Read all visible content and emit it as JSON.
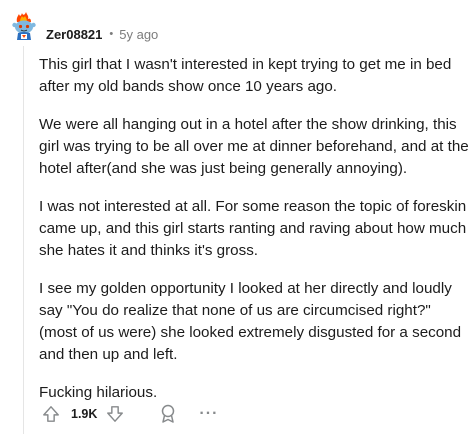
{
  "comment": {
    "author": "Zer08821",
    "separator": "•",
    "age": "5y ago",
    "avatar_icon": "snoo-avatar-icon",
    "paragraphs": [
      "This girl that I wasn't interested in kept trying to get me in bed after my old bands show once 10 years ago.",
      "We were all hanging out in a hotel after the show drinking, this girl was trying to be all over me at dinner beforehand, and at the hotel after(and she was just being generally annoying).",
      "I was not interested at all. For some reason the topic of foreskin came up, and this girl starts ranting and raving about how much she hates it and thinks it's gross.",
      "I see my golden opportunity I looked at her directly and loudly say \"You do realize that none of us are circumcised right?\" (most of us were) she looked extremely disgusted for a second and then up and left.",
      "Fucking hilarious."
    ],
    "actions": {
      "upvote_icon": "upvote-arrow-icon",
      "score": "1.9K",
      "downvote_icon": "downvote-arrow-icon",
      "award_icon": "award-icon",
      "more_icon": "more-options-icon",
      "more_label": "···"
    }
  },
  "colors": {
    "text": "#1c1c1c",
    "meta": "#7c7c7c",
    "icon": "#878a8c",
    "thread_line": "#e5e5e5"
  }
}
